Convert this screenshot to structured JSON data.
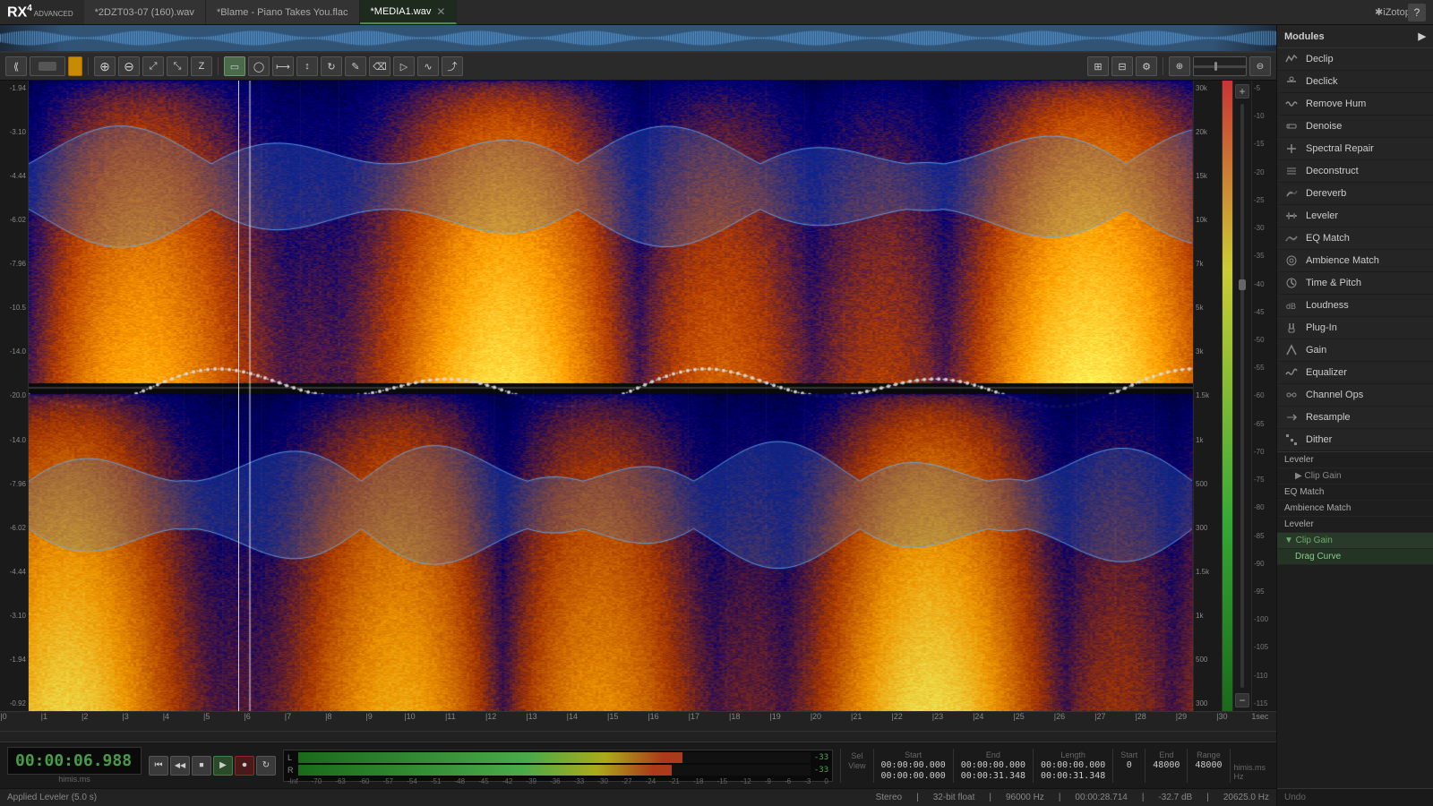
{
  "app": {
    "name": "RX 4",
    "version": "ADVANCED",
    "logo": "RX4"
  },
  "tabs": [
    {
      "id": "tab1",
      "label": "*2DZT03-07 (160).wav",
      "active": false,
      "closeable": false
    },
    {
      "id": "tab2",
      "label": "*Blame - Piano Takes You.flac",
      "active": false,
      "closeable": false
    },
    {
      "id": "tab3",
      "label": "*MEDIA1.wav",
      "active": true,
      "closeable": true
    }
  ],
  "modules": {
    "header": "Modules",
    "items": [
      {
        "id": "declip",
        "label": "Declip",
        "icon": "D"
      },
      {
        "id": "declick",
        "label": "Declick",
        "icon": "C"
      },
      {
        "id": "remove-hum",
        "label": "Remove Hum",
        "icon": "~"
      },
      {
        "id": "denoise",
        "label": "Denoise",
        "icon": "N"
      },
      {
        "id": "spectral-repair",
        "label": "Spectral Repair",
        "icon": "+"
      },
      {
        "id": "deconstruct",
        "label": "Deconstruct",
        "icon": "≡"
      },
      {
        "id": "dereverb",
        "label": "Dereverb",
        "icon": "R"
      },
      {
        "id": "leveler",
        "label": "Leveler",
        "icon": "L"
      },
      {
        "id": "eq-match",
        "label": "EQ Match",
        "icon": "EQ"
      },
      {
        "id": "ambience-match",
        "label": "Ambience Match",
        "icon": "AM"
      },
      {
        "id": "time-pitch",
        "label": "Time & Pitch",
        "icon": "T"
      },
      {
        "id": "loudness",
        "label": "Loudness",
        "icon": "dB"
      },
      {
        "id": "plug-in",
        "label": "Plug-In",
        "icon": "P"
      },
      {
        "id": "gain",
        "label": "Gain",
        "icon": "G"
      },
      {
        "id": "equalizer",
        "label": "Equalizer",
        "icon": "EQ"
      },
      {
        "id": "channel-ops",
        "label": "Channel Ops",
        "icon": "CH"
      },
      {
        "id": "resample",
        "label": "Resample",
        "icon": "RS"
      },
      {
        "id": "dither",
        "label": "Dither",
        "icon": "DI"
      }
    ]
  },
  "history": {
    "items": [
      {
        "label": "Leveler",
        "sub": null
      },
      {
        "label": "Clip Gain",
        "sub": null
      },
      {
        "label": "EQ Match",
        "sub": null
      },
      {
        "label": "Ambience Match",
        "sub": null
      },
      {
        "label": "Leveler",
        "sub": null
      },
      {
        "label": "Clip Gain",
        "sub": null,
        "active": true
      },
      {
        "label": "Drag Curve",
        "sub": null,
        "selected": true
      }
    ],
    "undo_label": "Undo"
  },
  "transport": {
    "time": "00:00:06.988",
    "time_sub": "himis.ms",
    "buttons": [
      "go-start",
      "go-back",
      "stop",
      "play",
      "record",
      "loop"
    ]
  },
  "timeline": {
    "markers": [
      "0",
      "1",
      "2",
      "3",
      "4",
      "5",
      "6",
      "7",
      "8",
      "9",
      "10",
      "11",
      "12",
      "13",
      "14",
      "15",
      "16",
      "17",
      "18",
      "19",
      "20",
      "21",
      "22",
      "23",
      "24",
      "25",
      "26",
      "27",
      "28",
      "29",
      "30",
      "1sec"
    ]
  },
  "db_scale_left": [
    "-1.94",
    "-3.10",
    "-4.44",
    "-6.02",
    "-7.96",
    "-10.5",
    "-14.0",
    "-20.0",
    "-14.0",
    "-7.96",
    "-6.02",
    "-4.44",
    "-3.10",
    "-1.94"
  ],
  "db_scale_right": [
    "-5",
    "-10",
    "-15",
    "-20",
    "-25",
    "-30",
    "-35",
    "-40",
    "-45",
    "-50",
    "-55",
    "-60",
    "-65",
    "-70",
    "-75",
    "-80",
    "-85",
    "-90",
    "-95",
    "-100",
    "-105",
    "-110",
    "-115"
  ],
  "hz_scale": [
    "30k",
    "20k",
    "15k",
    "10k",
    "7k",
    "5k",
    "3k",
    "1.5k",
    "1k",
    "500",
    "3k",
    "1.5k",
    "1k",
    "500"
  ],
  "selection": {
    "sel": {
      "start": "00:00:00.000",
      "end": "00:00:00.000",
      "length": "00:00:00.000"
    },
    "view": {
      "start": "00:00:00.000",
      "end": "00:00:31.348",
      "length": "00:00:31.348"
    },
    "start_hz": "0",
    "end_hz": "48000",
    "range_hz": "48000",
    "time_unit": "himis.ms",
    "hz_unit": "Hz"
  },
  "status": {
    "applied": "Applied Leveler (5.0 s)",
    "mode": "Stereo",
    "bit_depth": "32-bit float",
    "sample_rate": "96000 Hz",
    "duration": "00:00:28.714",
    "level": "-32.7 dB",
    "freq": "20625.0 Hz"
  },
  "meter": {
    "L_label": "L",
    "R_label": "R",
    "peak_L": "-33",
    "peak_R": "-33",
    "scale": [
      "-Inf",
      "-70",
      "-63",
      "-60",
      "-57",
      "-54",
      "-51",
      "-48",
      "-45",
      "-42",
      "-39",
      "-36",
      "-33",
      "-30",
      "-27",
      "-24",
      "-21",
      "-18",
      "-15",
      "-12",
      "-9",
      "-6",
      "-3",
      "0"
    ]
  },
  "toolbar": {
    "left_tools": [
      "zoom-scroll",
      "marquee-left",
      "zoom-slider"
    ],
    "mid_tools": [
      "select",
      "lasso",
      "harm-select",
      "time-select",
      "freq-select",
      "loop",
      "brush",
      "eraser",
      "play-sel",
      "gain-env"
    ],
    "right_tools": [
      "snap",
      "grid",
      "settings"
    ],
    "zoom_in": "+",
    "zoom_out": "-"
  }
}
